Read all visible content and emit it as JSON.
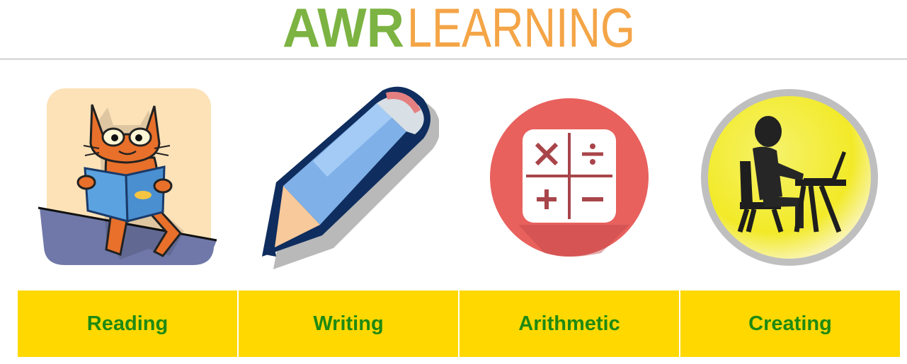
{
  "header": {
    "logo_bold": "AWR",
    "logo_light": "LEARNING",
    "logo_bold_color": "#7cb342",
    "logo_light_color": "#f4a547"
  },
  "subjects": [
    {
      "label": "Reading",
      "icon": "cat-reading-book-icon"
    },
    {
      "label": "Writing",
      "icon": "pencil-icon"
    },
    {
      "label": "Arithmetic",
      "icon": "calculator-icon"
    },
    {
      "label": "Creating",
      "icon": "person-at-computer-icon"
    }
  ],
  "colors": {
    "label_background": "#ffd800",
    "label_text": "#1f8a12",
    "arithmetic_circle": "#e8615d",
    "creating_circle": "#f4ea2a"
  }
}
